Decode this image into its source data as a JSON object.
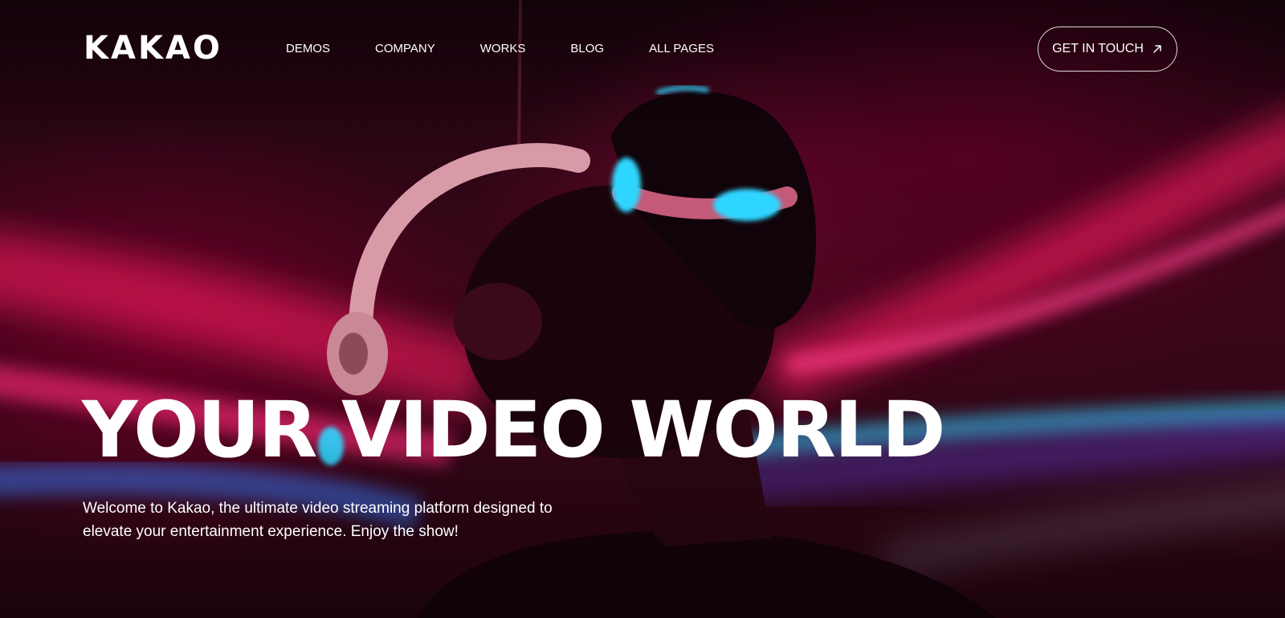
{
  "brand": {
    "logo_text": "KAKAO"
  },
  "nav": {
    "items": [
      {
        "label": "DEMOS"
      },
      {
        "label": "COMPANY"
      },
      {
        "label": "WORKS"
      },
      {
        "label": "BLOG"
      },
      {
        "label": "ALL PAGES"
      }
    ]
  },
  "cta": {
    "label": "GET IN TOUCH",
    "icon": "arrow-up-right-icon"
  },
  "hero": {
    "title": "YOUR VIDEO WORLD",
    "subtitle": "Welcome to Kakao, the ultimate video streaming platform designed to elevate your entertainment experience. Enjoy the show!"
  },
  "colors": {
    "text": "#ffffff",
    "accent_pink": "#ff1e6e",
    "accent_blue": "#2fd6ff",
    "background": "#2a0514"
  }
}
